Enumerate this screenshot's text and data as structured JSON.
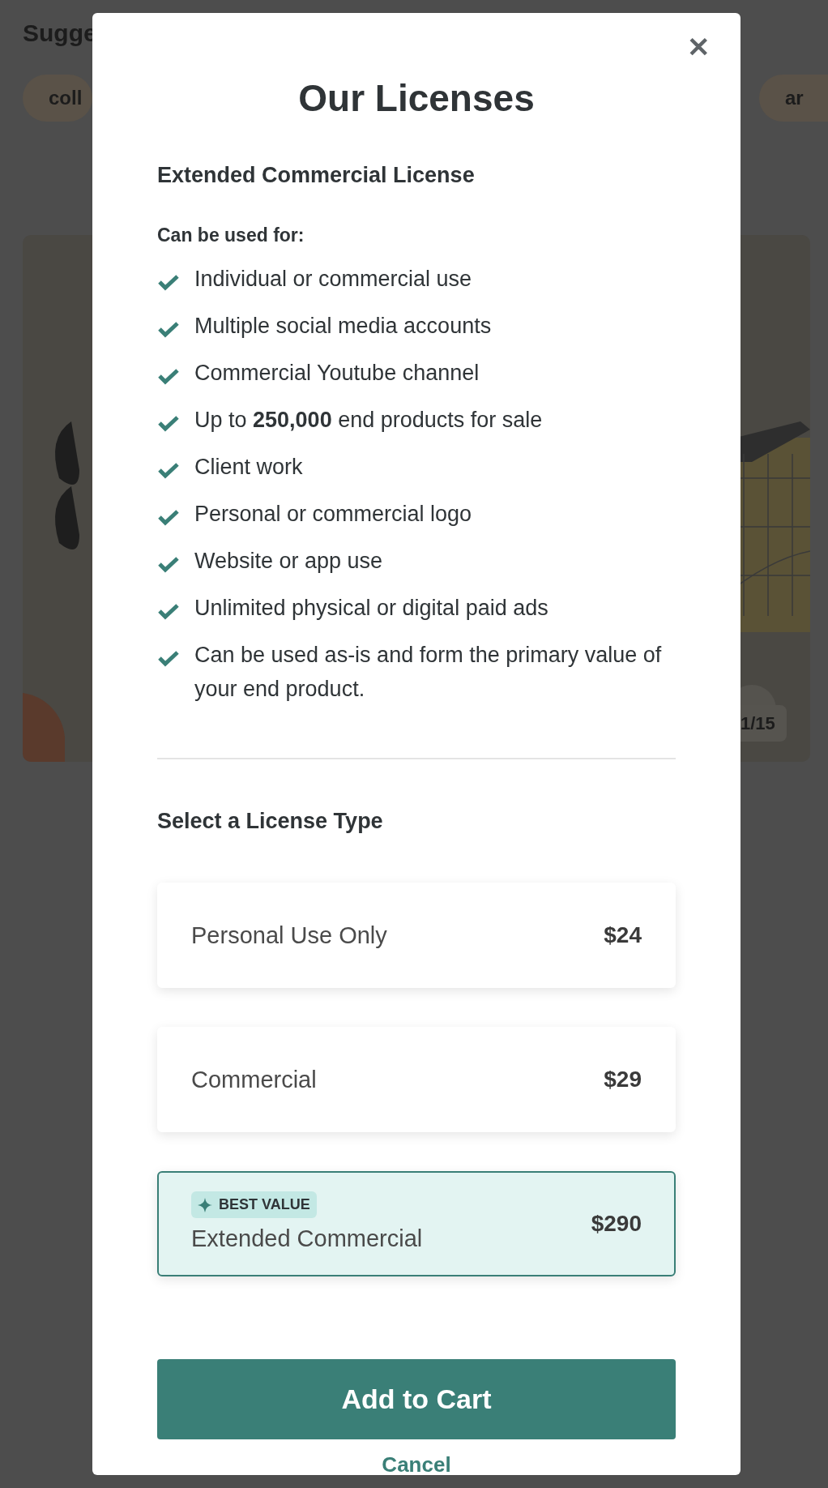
{
  "background": {
    "heading": "Sugge",
    "chips": [
      "coll",
      "ar"
    ],
    "product": {
      "kind": "picture",
      "counter": "1/15"
    }
  },
  "modal": {
    "close": "✕",
    "title": "Our Licenses",
    "license_name": "Extended Commercial License",
    "uses_heading": "Can be used for:",
    "uses": [
      "Individual or commercial use",
      "Multiple social media accounts",
      "Commercial Youtube channel",
      "Up to **250,000** end products for sale",
      "Client work",
      "Personal or commercial logo",
      "Website or app use",
      "Unlimited physical or digital paid ads",
      "Can be used as-is and form the primary value of your end product."
    ],
    "select_heading": "Select a License Type",
    "options": [
      {
        "name": "Personal Use Only",
        "price": "$24",
        "selected": false
      },
      {
        "name": "Commercial",
        "price": "$29",
        "selected": false
      },
      {
        "name": "Extended Commercial",
        "price": "$290",
        "selected": true,
        "badge": "BEST VALUE"
      }
    ],
    "primary_button": "Add to Cart",
    "cancel": "Cancel"
  }
}
